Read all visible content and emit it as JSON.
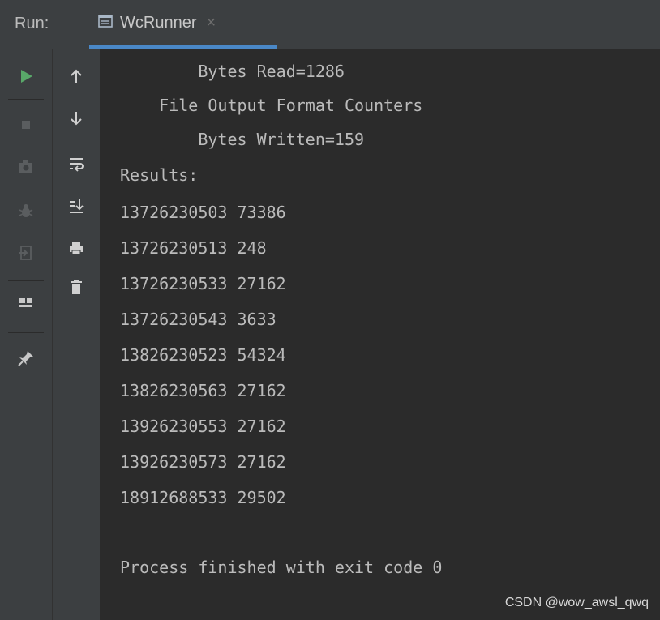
{
  "header": {
    "run_label": "Run:",
    "tab_title": "WcRunner",
    "close_glyph": "×"
  },
  "console": {
    "lines": [
      "        Bytes Read=1286",
      "    File Output Format Counters",
      "        Bytes Written=159",
      "Results:",
      "13726230503 73386",
      "13726230513 248",
      "13726230533 27162",
      "13726230543 3633",
      "13826230523 54324",
      "13826230563 27162",
      "13926230553 27162",
      "13926230573 27162",
      "18912688533 29502",
      "",
      "Process finished with exit code 0"
    ]
  },
  "watermark": "CSDN @wow_awsl_qwq",
  "colors": {
    "run_green": "#59a869",
    "accent_blue": "#4a88c7",
    "console_text": "#bbbbbb"
  }
}
